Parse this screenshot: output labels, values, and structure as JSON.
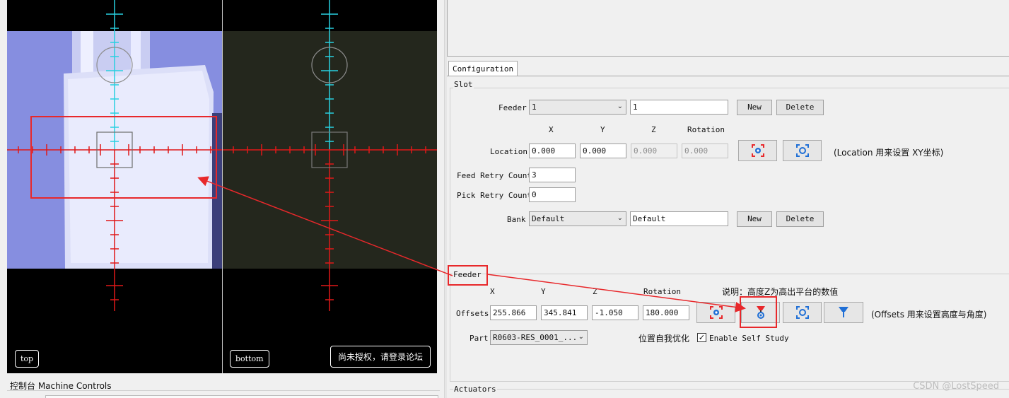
{
  "camera": {
    "top_label": "top",
    "bottom_label": "bottom",
    "notice": "尚未授权，请登录论坛"
  },
  "machine_controls": {
    "title": "控制台 Machine Controls"
  },
  "configuration": {
    "tab_label": "Configuration",
    "slot": {
      "group_title": "Slot",
      "feeder_label": "Feeder",
      "feeder_select": "1",
      "feeder_name": "1",
      "new_label": "New",
      "delete_label": "Delete",
      "col_x": "X",
      "col_y": "Y",
      "col_z": "Z",
      "col_rotation": "Rotation",
      "location_label": "Location",
      "location_x": "0.000",
      "location_y": "0.000",
      "location_z": "0.000",
      "location_rotation": "0.000",
      "location_note": "(Location 用来设置 XY坐标)",
      "feed_retry_label": "Feed Retry Count",
      "feed_retry_value": "3",
      "pick_retry_label": "Pick Retry Count",
      "pick_retry_value": "0",
      "bank_label": "Bank",
      "bank_select": "Default",
      "bank_name": "Default",
      "bank_new_label": "New",
      "bank_delete_label": "Delete"
    },
    "feeder": {
      "group_title": "Feeder",
      "col_x": "X",
      "col_y": "Y",
      "col_z": "Z",
      "col_rotation": "Rotation",
      "explain": "说明：高度Z为高出平台的数值",
      "offsets_label": "Offsets",
      "offsets_x": "255.866",
      "offsets_y": "345.841",
      "offsets_z": "-1.050",
      "offsets_rotation": "180.000",
      "offsets_note": "(Offsets 用来设置高度与角度)",
      "part_label": "Part",
      "part_select": "R0603-RES_0001_...",
      "self_opt_label": "位置自我优化",
      "self_study_label": "Enable Self Study",
      "self_study_checked": "✓"
    },
    "actuators": {
      "group_title": "Actuators"
    }
  },
  "watermark": "CSDN @LostSpeed",
  "colors": {
    "accent_red": "#e8282b",
    "crosshair_red": "#e01818",
    "crosshair_cyan": "#28d0e0",
    "icon_blue": "#1f6fd6"
  }
}
